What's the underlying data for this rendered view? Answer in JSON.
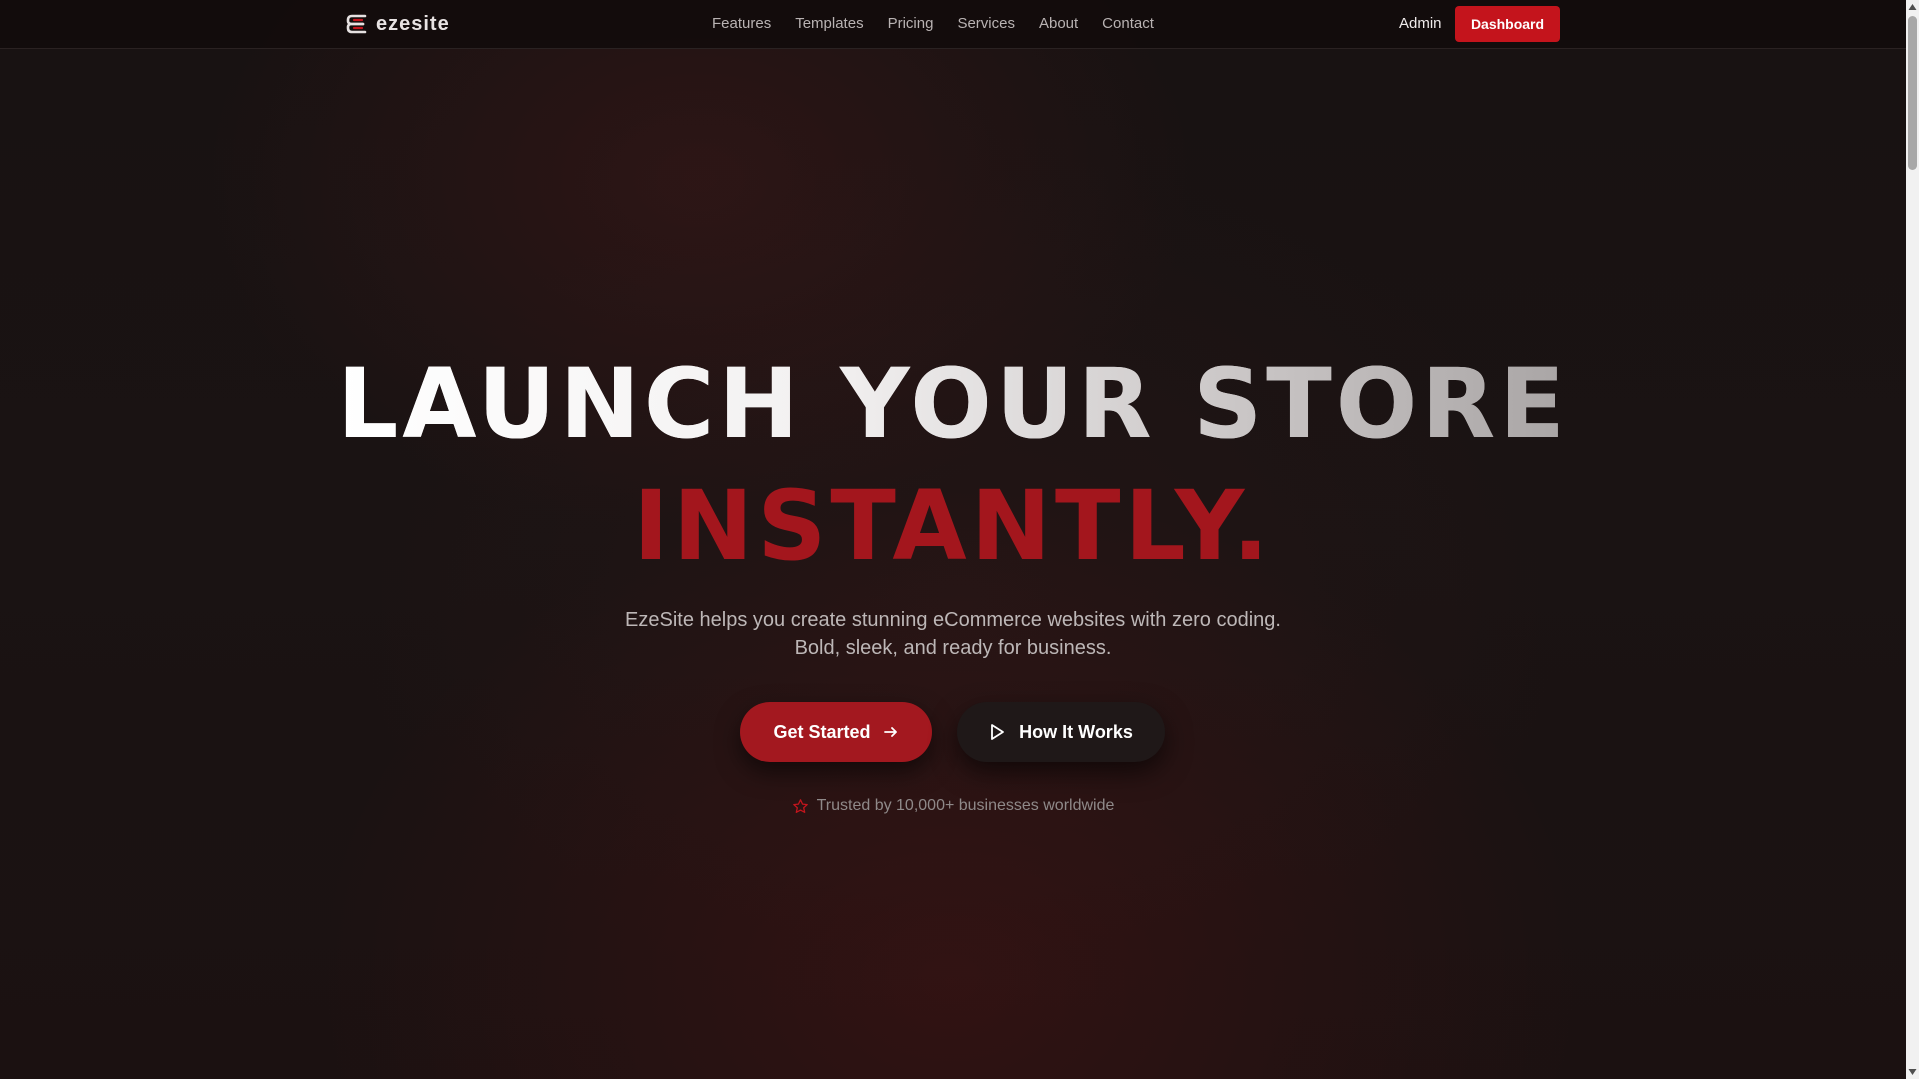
{
  "brand": {
    "name": "ezesite",
    "accent_color": "#c4141c",
    "hero_red": "#a3161d"
  },
  "nav": {
    "items": [
      {
        "label": "Features"
      },
      {
        "label": "Templates"
      },
      {
        "label": "Pricing"
      },
      {
        "label": "Services"
      },
      {
        "label": "About"
      },
      {
        "label": "Contact"
      }
    ],
    "admin_label": "Admin",
    "dashboard_label": "Dashboard"
  },
  "hero": {
    "title_line1": "LAUNCH YOUR STORE",
    "title_line2": "INSTANTLY.",
    "subtitle_line1": "EzeSite helps you create stunning eCommerce websites with zero coding.",
    "subtitle_line2": "Bold, sleek, and ready for business.",
    "primary_cta": "Get Started",
    "primary_cta_icon": "arrow-right-icon",
    "secondary_cta": "How It Works",
    "secondary_cta_icon": "play-icon",
    "trust_text": "Trusted by 10,000+ businesses worldwide",
    "trust_icon": "star-icon"
  }
}
